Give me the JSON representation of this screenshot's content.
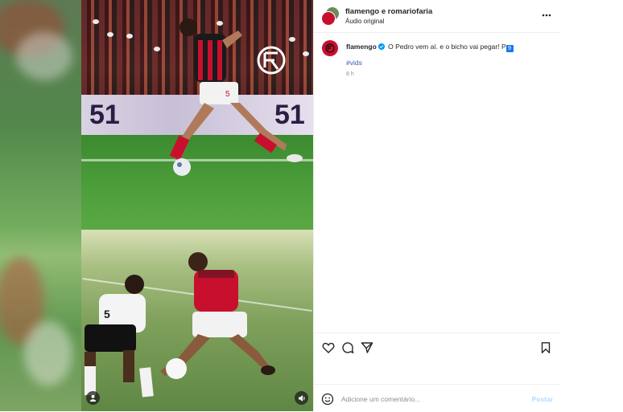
{
  "media": {
    "scoreboard_text_left": "51",
    "scoreboard_text_right": "51",
    "jersey_number": "5",
    "jersey_number_bottom": "5",
    "controls": {
      "tags_icon": "user-icon",
      "mute_icon": "speaker-icon"
    }
  },
  "header": {
    "title": "flamengo e romariofaria",
    "subtitle": "Áudio original",
    "more_icon": "more-horizontal-icon"
  },
  "caption": {
    "username": "flamengo",
    "text": "O Pedro vem aí. e o bicho vai pegar! P",
    "emoji": "9",
    "hashtag": "#vids",
    "time": "8 h"
  },
  "actions": {
    "like_icon": "heart-icon",
    "comment_icon": "comment-icon",
    "share_icon": "send-icon",
    "save_icon": "bookmark-icon"
  },
  "comment": {
    "placeholder": "Adicione um comentário...",
    "post_label": "Postar",
    "emoji_icon": "smiley-icon"
  },
  "colors": {
    "brand_red": "#c8102e",
    "link_blue": "#3e5aa8",
    "post_disabled": "#b3dbff"
  }
}
